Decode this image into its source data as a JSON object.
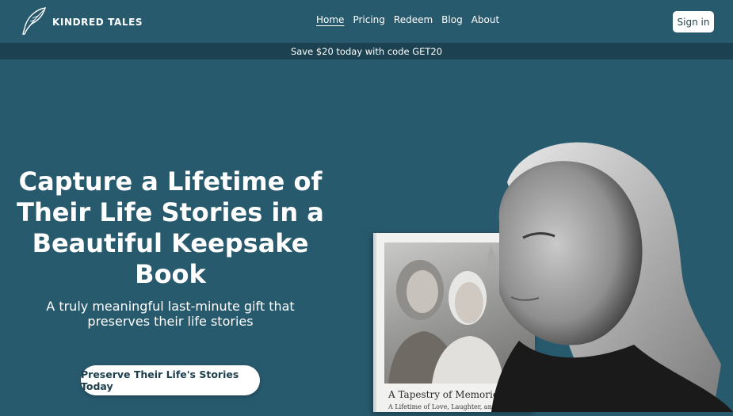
{
  "brand": {
    "name": "KINDRED TALES",
    "logo_icon": "quill-icon"
  },
  "nav": {
    "items": [
      {
        "label": "Home",
        "active": true
      },
      {
        "label": "Pricing",
        "active": false
      },
      {
        "label": "Redeem",
        "active": false
      },
      {
        "label": "Blog",
        "active": false
      },
      {
        "label": "About",
        "active": false
      }
    ],
    "signin_label": "Sign in"
  },
  "promo": {
    "text": "Save $20 today with code GET20"
  },
  "hero": {
    "title": "Capture a Lifetime of Their Life Stories in a Beautiful Keepsake Book",
    "subtitle": "A truly meaningful last-minute gift that preserves their life stories",
    "cta_label": "Preserve Their Life's Stories Today"
  },
  "book": {
    "title": "A Tapestry of Memories",
    "subtitle": "A Lifetime of Love, Laughter, and L"
  },
  "colors": {
    "background": "#285a6e",
    "promo_bar": "#1c4252",
    "button_text": "#1d3f4d"
  }
}
